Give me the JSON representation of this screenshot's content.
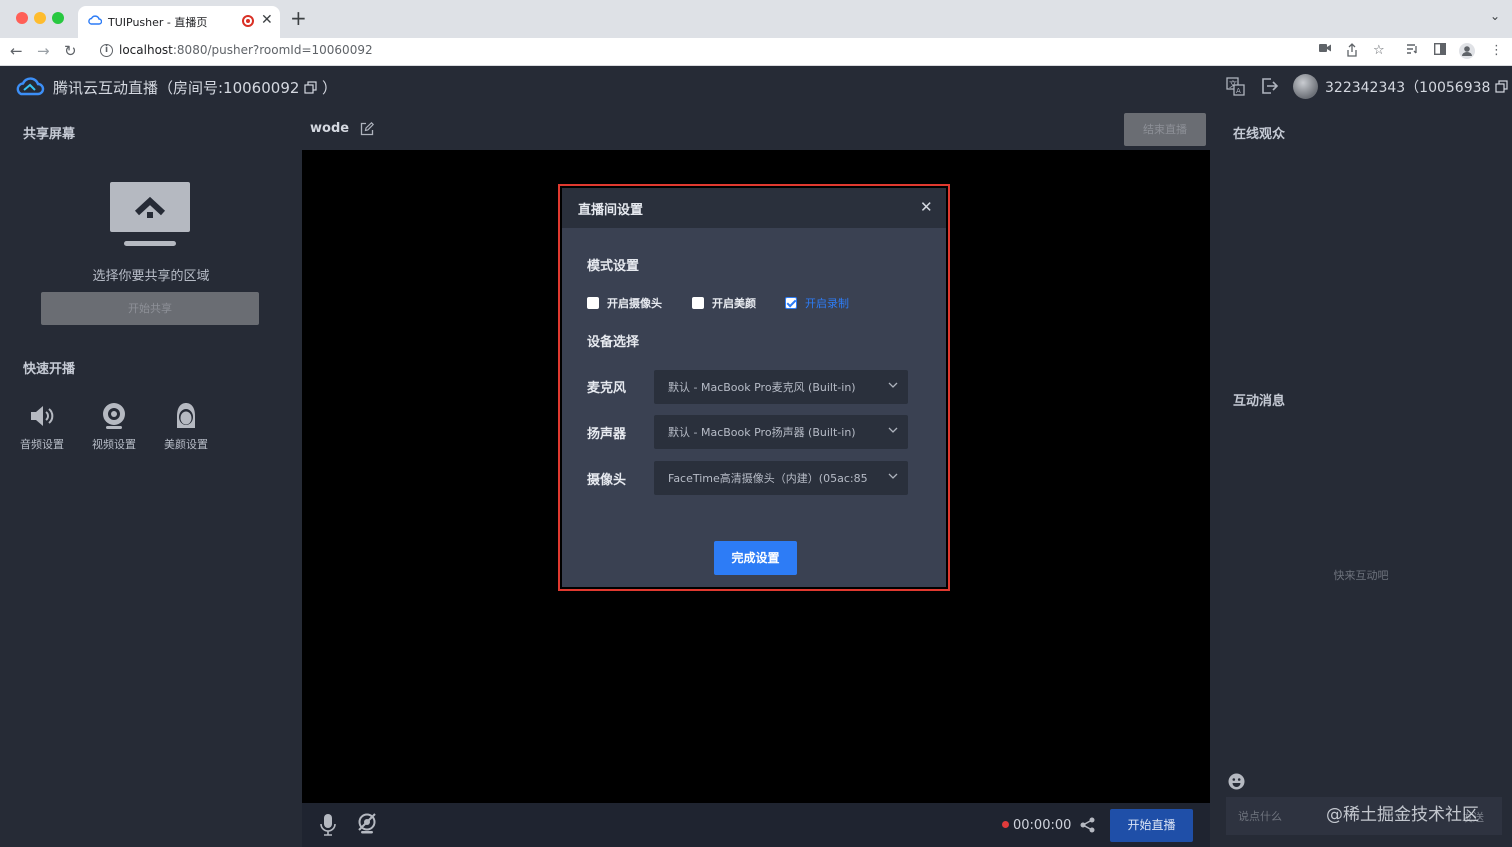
{
  "browser": {
    "tab_title": "TUIPusher - 直播页",
    "url_host": "localhost",
    "url_path": ":8080/pusher?roomId=10060092"
  },
  "header": {
    "app_title": "腾讯云互动直播（房间号:10060092",
    "app_title_end": "）",
    "user_info": "322342343（10056938",
    "user_info_end": "）"
  },
  "left_panel": {
    "share_title": "共享屏幕",
    "share_hint": "选择你要共享的区域",
    "share_button": "开始共享",
    "quick_title": "快速开播",
    "quick_items": [
      {
        "label": "音频设置",
        "icon": "speaker-icon"
      },
      {
        "label": "视频设置",
        "icon": "webcam-icon"
      },
      {
        "label": "美颜设置",
        "icon": "face-icon"
      }
    ]
  },
  "center": {
    "room_name": "wode",
    "end_button": "结束直播",
    "timer": "00:00:00",
    "start_button": "开始直播"
  },
  "right_panel": {
    "audience_title": "在线观众",
    "messages_title": "互动消息",
    "empty_hint": "快来互动吧",
    "input_placeholder": "说点什么",
    "send_label": "发送",
    "watermark": "@稀土掘金技术社区"
  },
  "modal": {
    "title": "直播间设置",
    "mode_title": "模式设置",
    "checkboxes": [
      {
        "label": "开启摄像头",
        "checked": false
      },
      {
        "label": "开启美颜",
        "checked": false
      },
      {
        "label": "开启录制",
        "checked": true
      }
    ],
    "device_title": "设备选择",
    "devices": [
      {
        "label": "麦克风",
        "value": "默认 - MacBook Pro麦克风 (Built-in)"
      },
      {
        "label": "扬声器",
        "value": "默认 - MacBook Pro扬声器 (Built-in)"
      },
      {
        "label": "摄像头",
        "value": "FaceTime高清摄像头（内建）(05ac:85"
      }
    ],
    "done_button": "完成设置"
  },
  "colors": {
    "accent": "#2d7cf6",
    "highlight_border": "#e0392f",
    "panel_bg": "#262b36",
    "modal_bg": "#3a4152"
  }
}
